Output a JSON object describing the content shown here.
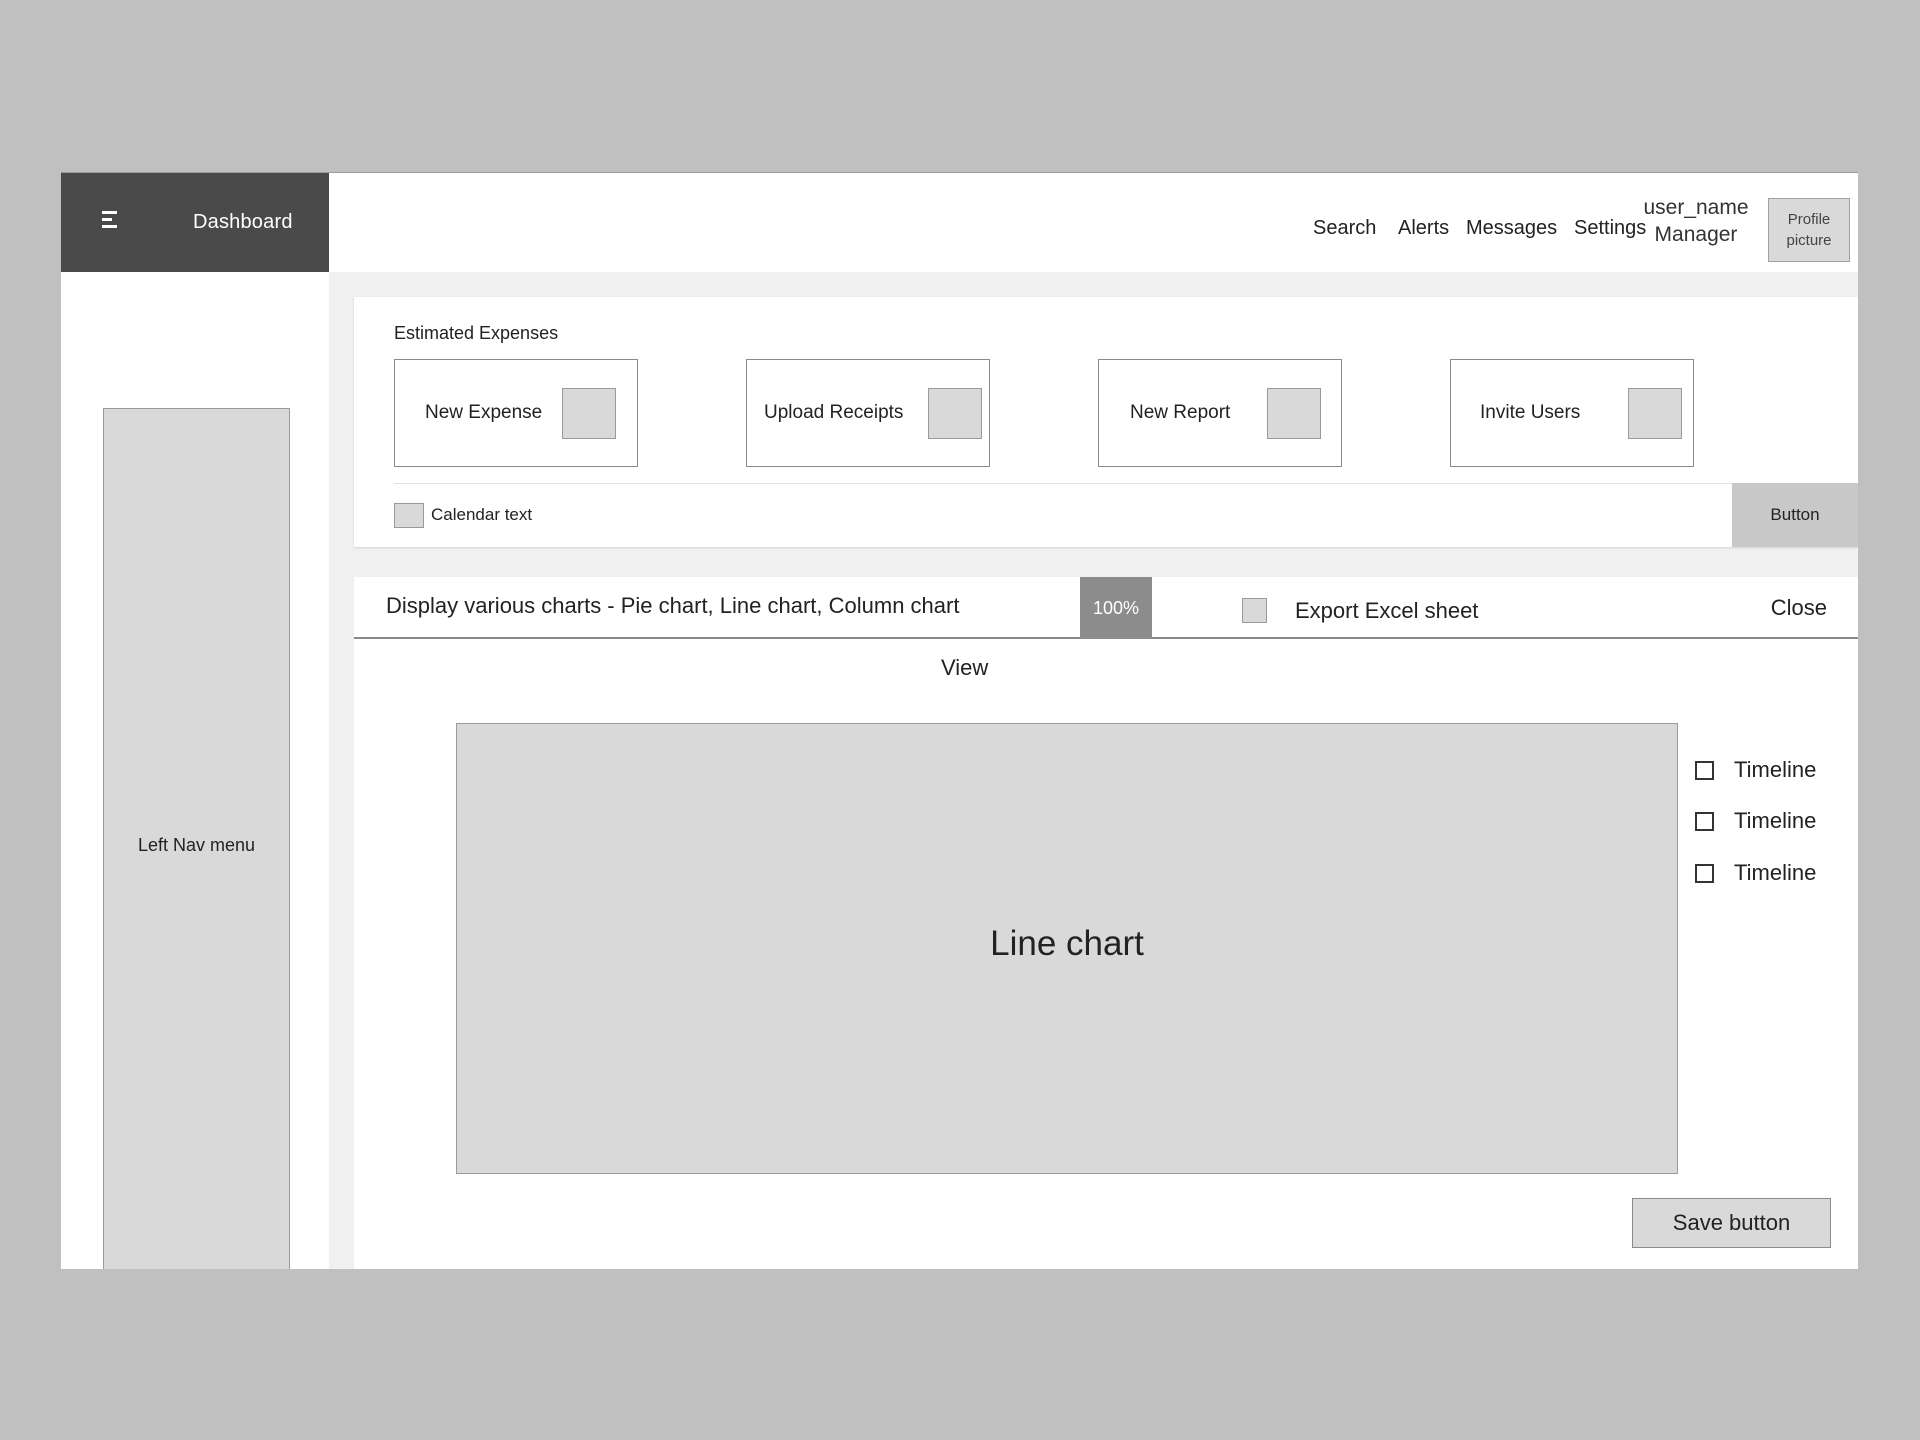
{
  "brand": {
    "title": "Dashboard",
    "menu_icon": "hamburger-menu-icon"
  },
  "header": {
    "nav": [
      "Search",
      "Alerts",
      "Messages",
      "Settings"
    ],
    "user_name": "user_name",
    "user_role": "Manager",
    "profile_line1": "Profile",
    "profile_line2": "picture"
  },
  "left_nav": {
    "label": "Left Nav menu"
  },
  "expenses": {
    "title": "Estimated Expenses",
    "actions": [
      "New Expense",
      "Upload Receipts",
      "New Report",
      "Invite Users"
    ],
    "calendar_text": "Calendar text",
    "button_label": "Button"
  },
  "charts": {
    "toolbar_title": "Display various charts - Pie chart, Line chart, Column chart",
    "zoom": "100%",
    "export_label": "Export Excel sheet",
    "close_label": "Close",
    "view_label": "View",
    "chart_placeholder": "Line chart",
    "legend": [
      "Timeline",
      "Timeline",
      "Timeline"
    ],
    "save_label": "Save button"
  },
  "colors": {
    "background": "#c0c0c0",
    "brand": "#4a4a4a",
    "placeholder": "#d9d9d9",
    "zoom_badge": "#8c8c8c"
  }
}
